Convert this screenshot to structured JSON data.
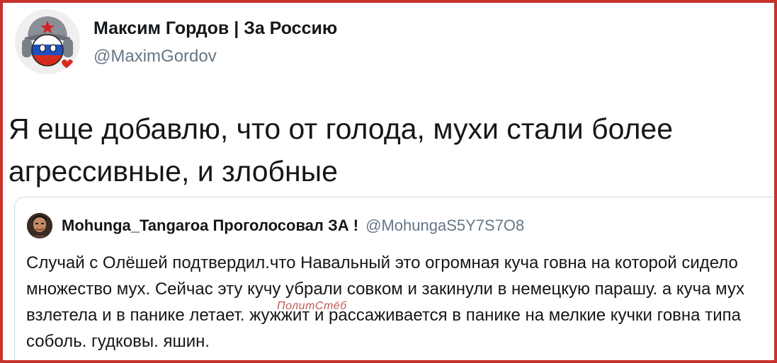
{
  "tweet": {
    "author": {
      "display_name": "Максим Гордов | За Россию",
      "handle": "@MaximGordov",
      "avatar_icon": "countryball-avatar-icon"
    },
    "text": "Я еще добавлю, что от голода, мухи стали более агрессивные, и злобные"
  },
  "quoted_tweet": {
    "author": {
      "display_name": "Mohunga_Tangaroa Проголосовал ЗА !",
      "handle": "@MohungaS5Y7S7O8",
      "avatar_icon": "person-avatar-icon"
    },
    "text": "Случай с Олёшей подтвердил.что Навальный это огромная куча говна на которой сидело множество мух. Сейчас эту кучу убрали совком и закинули в немецкую парашу. а куча мух взлетела и в панике летает. жужжит и рассаживается в панике на мелкие кучки говна типа соболь. гудковы. яшин."
  },
  "watermark": {
    "text": "ПолитСтёб"
  },
  "colors": {
    "border": "#c8322d",
    "text": "#14171a",
    "secondary_text": "#657786",
    "quote_border": "#cfd9de"
  }
}
